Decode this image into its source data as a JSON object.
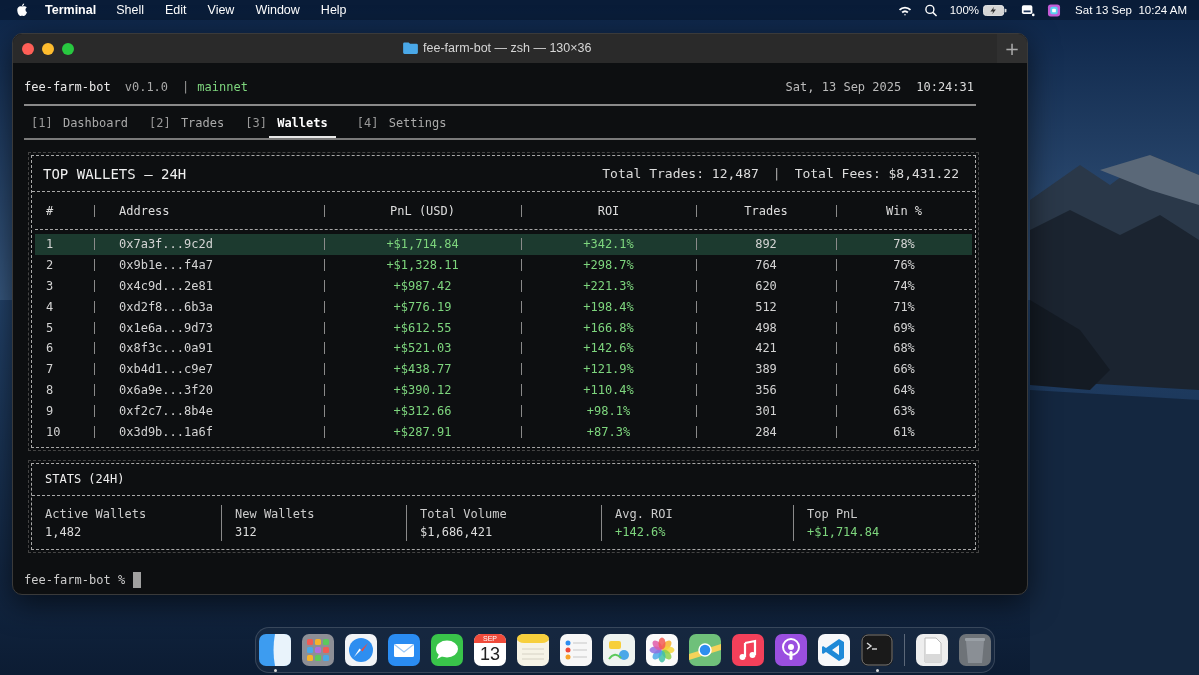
{
  "menu_bar": {
    "app": "Terminal",
    "menus": [
      "Shell",
      "Edit",
      "View",
      "Window",
      "Help"
    ],
    "battery": "100%",
    "clock": "Sat 13 Sep  10:24 AM"
  },
  "window": {
    "title": "fee-farm-bot — zsh — 130×36",
    "new_tab": "+"
  },
  "header": {
    "app": "fee-farm-bot",
    "version": "v0.1.0",
    "separator": "|",
    "network": "mainnet",
    "date": "Sat, 13 Sep 2025",
    "time": "10:24:31"
  },
  "tabs": [
    {
      "key": "[1]",
      "label": "Dashboard",
      "selected": false
    },
    {
      "key": "[2]",
      "label": "Trades",
      "selected": false
    },
    {
      "key": "[3]",
      "label": "Wallets",
      "selected": true
    },
    {
      "key": "[4]",
      "label": "Settings",
      "selected": false
    }
  ],
  "wallets_table": {
    "title": "TOP WALLETS — 24H",
    "total_trades": "Total Trades: 12,487",
    "separator": "|",
    "total_fees": "Total Fees: $8,431.22",
    "columns": [
      "#",
      "Address",
      "PnL (USD)",
      "ROI",
      "Trades",
      "Win %"
    ],
    "rows": [
      {
        "rank": "1",
        "address": "0x7a3f...9c2d",
        "pnl": "+$1,714.84",
        "roi": "+342.1%",
        "trades": "892",
        "win": "78%",
        "selected": true
      },
      {
        "rank": "2",
        "address": "0x9b1e...f4a7",
        "pnl": "+$1,328.11",
        "roi": "+298.7%",
        "trades": "764",
        "win": "76%",
        "selected": false
      },
      {
        "rank": "3",
        "address": "0x4c9d...2e81",
        "pnl": "+$987.42",
        "roi": "+221.3%",
        "trades": "620",
        "win": "74%",
        "selected": false
      },
      {
        "rank": "4",
        "address": "0xd2f8...6b3a",
        "pnl": "+$776.19",
        "roi": "+198.4%",
        "trades": "512",
        "win": "71%",
        "selected": false
      },
      {
        "rank": "5",
        "address": "0x1e6a...9d73",
        "pnl": "+$612.55",
        "roi": "+166.8%",
        "trades": "498",
        "win": "69%",
        "selected": false
      },
      {
        "rank": "6",
        "address": "0x8f3c...0a91",
        "pnl": "+$521.03",
        "roi": "+142.6%",
        "trades": "421",
        "win": "68%",
        "selected": false
      },
      {
        "rank": "7",
        "address": "0xb4d1...c9e7",
        "pnl": "+$438.77",
        "roi": "+121.9%",
        "trades": "389",
        "win": "66%",
        "selected": false
      },
      {
        "rank": "8",
        "address": "0x6a9e...3f20",
        "pnl": "+$390.12",
        "roi": "+110.4%",
        "trades": "356",
        "win": "64%",
        "selected": false
      },
      {
        "rank": "9",
        "address": "0xf2c7...8b4e",
        "pnl": "+$312.66",
        "roi": "+98.1%",
        "trades": "301",
        "win": "63%",
        "selected": false
      },
      {
        "rank": "10",
        "address": "0x3d9b...1a6f",
        "pnl": "+$287.91",
        "roi": "+87.3%",
        "trades": "284",
        "win": "61%",
        "selected": false
      }
    ]
  },
  "stats": {
    "title": "STATS (24H)",
    "items": [
      {
        "label": "Active Wallets",
        "value": "1,482",
        "kind": "plain"
      },
      {
        "label": "New Wallets",
        "value": "312",
        "kind": "plain"
      },
      {
        "label": "Total Volume",
        "value": "$1,686,421",
        "kind": "plain"
      },
      {
        "label": "Avg. ROI",
        "value": "+142.6%",
        "kind": "gain"
      },
      {
        "label": "Top PnL",
        "value": "+$1,714.84",
        "kind": "gain"
      }
    ]
  },
  "prompt": "fee-farm-bot %",
  "dock": [
    {
      "kind": "finder",
      "running": true
    },
    {
      "kind": "launchpad",
      "running": false
    },
    {
      "kind": "safari",
      "running": false
    },
    {
      "kind": "mail",
      "running": false
    },
    {
      "kind": "messages",
      "running": false
    },
    {
      "kind": "calendar",
      "month": "SEP",
      "day": "13",
      "running": false
    },
    {
      "kind": "notes",
      "running": false
    },
    {
      "kind": "reminders",
      "running": false
    },
    {
      "kind": "freeform",
      "running": false
    },
    {
      "kind": "photos",
      "running": false
    },
    {
      "kind": "maps",
      "running": false
    },
    {
      "kind": "music",
      "running": false
    },
    {
      "kind": "podcasts",
      "running": false
    },
    {
      "kind": "editor",
      "running": false
    },
    {
      "kind": "terminal",
      "running": true
    },
    {
      "kind": "separator"
    },
    {
      "kind": "document",
      "running": false
    },
    {
      "kind": "trash",
      "running": false
    }
  ]
}
